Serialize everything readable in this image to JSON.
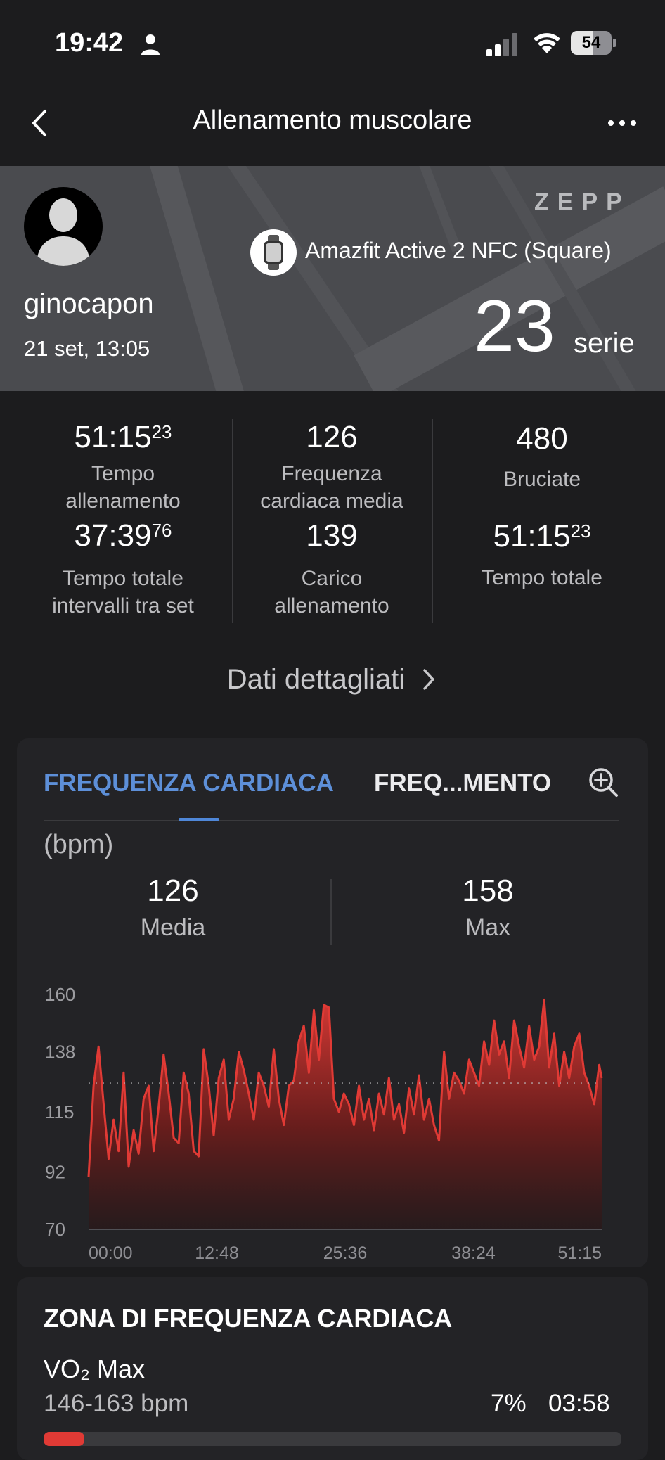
{
  "status_bar": {
    "time": "19:42",
    "battery": "54",
    "battery_level": 0.54
  },
  "nav": {
    "title": "Allenamento muscolare"
  },
  "header": {
    "brand": "ZEPP",
    "username": "ginocapon",
    "date": "21 set, 13:05",
    "device": "Amazfit Active 2 NFC (Square)",
    "sets_value": "23",
    "sets_unit": "serie"
  },
  "stats": {
    "col1": {
      "v1_main": "51:15",
      "v1_sup": "23",
      "l1": "Tempo allenamento",
      "v2_main": "37:39",
      "v2_sup": "76",
      "l2a": "Tempo totale",
      "l2b": "intervalli tra set"
    },
    "col2": {
      "v1": "126",
      "l1a": "Frequenza",
      "l1b": "cardiaca media",
      "v2": "139",
      "l2a": "Carico",
      "l2b": "allenamento"
    },
    "col3": {
      "v1": "480",
      "l1": "Bruciate",
      "v2_main": "51:15",
      "v2_sup": "23",
      "l2": "Tempo totale"
    }
  },
  "details_link": "Dati dettagliati",
  "hr_card": {
    "tab_active": "FREQUENZA CARDIACA",
    "tab_other": "FREQ...MENTO",
    "unit": "(bpm)",
    "avg_value": "126",
    "avg_label": "Media",
    "max_value": "158",
    "max_label": "Max"
  },
  "chart_data": {
    "type": "area",
    "title": "",
    "xlabel": "",
    "ylabel": "(bpm)",
    "ylim": [
      70,
      160
    ],
    "yticks": [
      "160",
      "138",
      "115",
      "92",
      "70"
    ],
    "xticks": [
      "00:00",
      "12:48",
      "25:36",
      "38:24",
      "51:15"
    ],
    "xlim_minutes": [
      0,
      51.25
    ],
    "average": 126,
    "color": "#e03a35",
    "series": [
      {
        "x": [
          0,
          0.5,
          1,
          1.5,
          2,
          2.5,
          3,
          3.5,
          4,
          4.5,
          5,
          5.5,
          6,
          6.5,
          7,
          7.5,
          8,
          8.5,
          9,
          9.5,
          10,
          10.5,
          11,
          11.5,
          12,
          12.5,
          13,
          13.5,
          14,
          14.5,
          15,
          15.5,
          16,
          16.5,
          17,
          17.5,
          18,
          18.5,
          19,
          19.5,
          20,
          20.5,
          21,
          21.5,
          22,
          22.5,
          23,
          23.5,
          24,
          24.5,
          25,
          25.5,
          26,
          26.5,
          27,
          27.5,
          28,
          28.5,
          29,
          29.5,
          30,
          30.5,
          31,
          31.5,
          32,
          32.5,
          33,
          33.5,
          34,
          34.5,
          35,
          35.5,
          36,
          36.5,
          37,
          37.5,
          38,
          38.5,
          39,
          39.5,
          40,
          40.5,
          41,
          41.5,
          42,
          42.5,
          43,
          43.5,
          44,
          44.5,
          45,
          45.5,
          46,
          46.5,
          47,
          47.5,
          48,
          48.5,
          49,
          49.5,
          50,
          50.5,
          51,
          51.25
        ],
        "values": [
          90,
          125,
          140,
          118,
          97,
          112,
          100,
          130,
          94,
          108,
          99,
          120,
          125,
          100,
          117,
          137,
          122,
          105,
          103,
          130,
          122,
          100,
          98,
          139,
          125,
          106,
          128,
          135,
          112,
          120,
          138,
          131,
          122,
          112,
          130,
          125,
          117,
          139,
          120,
          110,
          125,
          127,
          142,
          148,
          130,
          154,
          135,
          156,
          155,
          120,
          115,
          122,
          118,
          110,
          125,
          112,
          120,
          108,
          122,
          114,
          128,
          112,
          118,
          107,
          124,
          114,
          129,
          112,
          120,
          110,
          104,
          138,
          120,
          130,
          127,
          122,
          135,
          130,
          125,
          142,
          133,
          150,
          137,
          142,
          128,
          150,
          140,
          132,
          148,
          135,
          140,
          158,
          132,
          145,
          125,
          138,
          128,
          140,
          145,
          130,
          125,
          118,
          133,
          128
        ]
      }
    ]
  },
  "zone_card": {
    "title": "ZONA DI FREQUENZA CARDIACA",
    "zone_name": "VO₂ Max",
    "zone_range": "146-163 bpm",
    "zone_pct": "7%",
    "zone_time": "03:58",
    "zone_fraction": 0.07
  }
}
